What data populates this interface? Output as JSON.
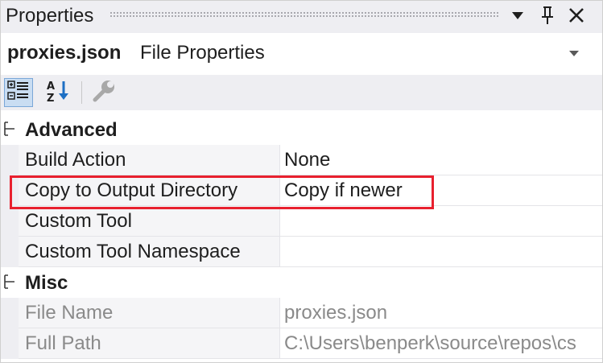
{
  "panel": {
    "title": "Properties",
    "controls": [
      {
        "name": "window-position-dropdown",
        "icon": "chevron-down-icon"
      },
      {
        "name": "auto-hide-pin",
        "icon": "pin-icon"
      },
      {
        "name": "close",
        "icon": "close-icon"
      }
    ]
  },
  "object_selector": {
    "name": "proxies.json",
    "type": "File Properties",
    "dropdown_icon": "chevron-down-icon"
  },
  "toolbar": {
    "buttons": [
      {
        "name": "categorized",
        "icon": "categorized-icon",
        "active": true
      },
      {
        "name": "alphabetical",
        "icon": "sort-az-icon",
        "active": false
      },
      {
        "name": "property-pages",
        "icon": "wrench-icon",
        "active": false,
        "disabled": true
      }
    ]
  },
  "categories": [
    {
      "label": "Advanced",
      "expanded": true,
      "properties": [
        {
          "name": "Build Action",
          "value": "None"
        },
        {
          "name": "Copy to Output Directory",
          "value": "Copy if newer",
          "highlighted": true
        },
        {
          "name": "Custom Tool",
          "value": ""
        },
        {
          "name": "Custom Tool Namespace",
          "value": ""
        }
      ]
    },
    {
      "label": "Misc",
      "expanded": true,
      "properties": [
        {
          "name": "File Name",
          "value": "proxies.json",
          "readonly": true
        },
        {
          "name": "Full Path",
          "value": "C:\\Users\\benperk\\source\\repos\\cs",
          "readonly": true
        }
      ]
    }
  ],
  "colors": {
    "highlight_border": "#e8202e",
    "toolbar_bg": "#eeeef2",
    "active_tool_bg": "#c9ddf2",
    "readonly_text": "#8a8a8a"
  }
}
